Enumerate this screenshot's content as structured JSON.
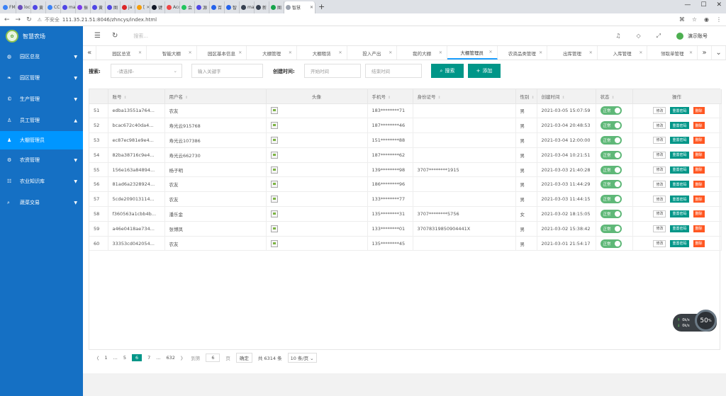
{
  "browser": {
    "tabs": [
      {
        "label": "FMS",
        "color": "#3b82f6"
      },
      {
        "label": "loca",
        "color": "#6b4fbb"
      },
      {
        "label": "黄",
        "color": "#4f46e5"
      },
      {
        "label": "CC",
        "color": "#3b82f6"
      },
      {
        "label": "ma",
        "color": "#4f46e5"
      },
      {
        "label": "振",
        "color": "#7c3aed"
      },
      {
        "label": "黄",
        "color": "#4f46e5"
      },
      {
        "label": "图",
        "color": "#4f46e5"
      },
      {
        "label": "ja",
        "color": "#dc2626"
      },
      {
        "label": "[",
        "color": "#f59e0b"
      },
      {
        "label": "键",
        "color": "#111827"
      },
      {
        "label": "Acc",
        "color": "#ef4444"
      },
      {
        "label": "会",
        "color": "#22c55e"
      },
      {
        "label": "源",
        "color": "#4f46e5"
      },
      {
        "label": "百",
        "color": "#2563eb"
      },
      {
        "label": "智",
        "color": "#2563eb"
      },
      {
        "label": "ma",
        "color": "#374151"
      },
      {
        "label": "新",
        "color": "#374151"
      },
      {
        "label": "图",
        "color": "#16a34a"
      }
    ],
    "active_tab": "智慧",
    "new_tab": "+",
    "security": "不安全",
    "url": "111.35.21.51:8046/zhncys/index.html"
  },
  "sidebar": {
    "logo_text": "智慧农场",
    "items": [
      {
        "label": "园区总览",
        "icon": "◍",
        "arrow": "▼"
      },
      {
        "label": "园区管理",
        "icon": "❧",
        "arrow": "▼"
      },
      {
        "label": "生产管理",
        "icon": "©",
        "arrow": "▼"
      },
      {
        "label": "员工管理",
        "icon": "♙",
        "arrow": "▲"
      }
    ],
    "sub_active": {
      "label": "大棚管理员",
      "icon": "♟"
    },
    "items2": [
      {
        "label": "农资管理",
        "icon": "⚙",
        "arrow": "▼"
      },
      {
        "label": "农业知识库",
        "icon": "☷",
        "arrow": "▼"
      },
      {
        "label": "蔬菜交易",
        "icon": "⌕",
        "arrow": "▼"
      }
    ]
  },
  "topbar": {
    "menu_icon": "☰",
    "refresh_icon": "↻",
    "search_placeholder": "搜索...",
    "bell_icon": "♫",
    "tag_icon": "◇",
    "fullscreen_icon": "⤢",
    "user": "演示账号"
  },
  "pagetabs": {
    "tabs": [
      "园区总览",
      "智能大棚",
      "园区基本信息",
      "大棚管理",
      "大棚租赁",
      "投入产出",
      "我的大棚",
      "大棚管理员",
      "农资品类管理",
      "出库管理",
      "入库管理",
      "领取单管理"
    ],
    "active_index": 7,
    "left_icon": "«",
    "right_icon": "»",
    "down_icon": "⌄"
  },
  "search": {
    "label": "搜索:",
    "select_placeholder": "-请选择-",
    "keyword_placeholder": "输入关键字",
    "time_label": "创建时间:",
    "start_placeholder": "开始时间",
    "end_placeholder": "结束时间",
    "search_btn": "搜索",
    "add_btn": "添加"
  },
  "table": {
    "headers": [
      "",
      "账号",
      "用户名",
      "头像",
      "手机号",
      "身份证号",
      "性别",
      "创建时间",
      "状态",
      "操作"
    ],
    "status_label": "正常",
    "op_labels": {
      "edit": "修改",
      "reset": "重置密码",
      "del": "删除"
    },
    "rows": [
      {
        "no": "51",
        "account": "edba13551a764...",
        "name": "农友",
        "phone": "183********71",
        "id": "",
        "gender": "男",
        "time": "2021-03-05 15:07:59"
      },
      {
        "no": "52",
        "account": "bcac672c40da4...",
        "name": "寿光云915768",
        "phone": "187********46",
        "id": "",
        "gender": "男",
        "time": "2021-03-04 20:48:53"
      },
      {
        "no": "53",
        "account": "ec87ec981e9e4...",
        "name": "寿光云107386",
        "phone": "151********88",
        "id": "",
        "gender": "男",
        "time": "2021-03-04 12:00:00"
      },
      {
        "no": "54",
        "account": "82ba38716c9e4...",
        "name": "寿光云662730",
        "phone": "187********62",
        "id": "",
        "gender": "男",
        "time": "2021-03-04 10:21:51"
      },
      {
        "no": "55",
        "account": "156e163a84894...",
        "name": "杨子明",
        "phone": "139********98",
        "id": "3707********1915",
        "gender": "男",
        "time": "2021-03-03 21:40:28"
      },
      {
        "no": "56",
        "account": "81ad6a2328924...",
        "name": "农友",
        "phone": "186********96",
        "id": "",
        "gender": "男",
        "time": "2021-03-03 11:44:29"
      },
      {
        "no": "57",
        "account": "5cde209013114...",
        "name": "农友",
        "phone": "133********77",
        "id": "",
        "gender": "男",
        "time": "2021-03-03 11:44:15"
      },
      {
        "no": "58",
        "account": "f360563a1cbb4b...",
        "name": "潘乐金",
        "phone": "135********31",
        "id": "3707********5756",
        "gender": "女",
        "time": "2021-03-02 18:15:05"
      },
      {
        "no": "59",
        "account": "a46e0418ae734...",
        "name": "张博凤",
        "phone": "133********01",
        "id": "37078319850904441X",
        "gender": "男",
        "time": "2021-03-02 15:38:42"
      },
      {
        "no": "60",
        "account": "33353cd042054...",
        "name": "农友",
        "phone": "135********45",
        "id": "",
        "gender": "男",
        "time": "2021-03-01 21:54:17"
      }
    ]
  },
  "pager": {
    "prev": "〈",
    "p1": "1",
    "dots1": "...",
    "p5": "5",
    "current": "6",
    "p7": "7",
    "dots2": "...",
    "last": "632",
    "next": "〉",
    "goto_label": "到第",
    "goto_value": "6",
    "page_unit": "页",
    "confirm": "确定",
    "total": "共 6314 条",
    "page_size": "10 条/页"
  },
  "widget": {
    "line1": "0k/s",
    "line2": "0k/s",
    "percent": "50"
  }
}
